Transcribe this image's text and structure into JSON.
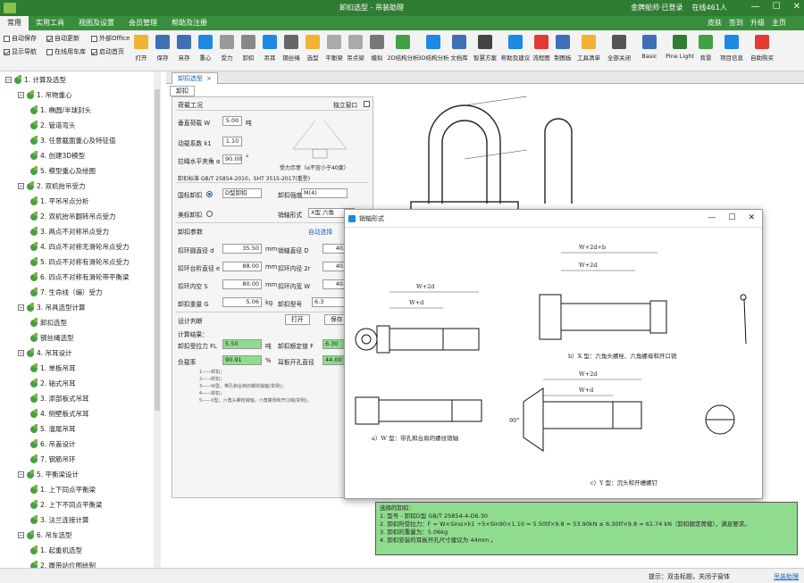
{
  "window": {
    "title": "卸扣选型 - 吊装助理",
    "user_status": "金牌船师·已登录",
    "online": "在线461人",
    "controls": [
      "—",
      "☐",
      "✕"
    ]
  },
  "menu": {
    "items": [
      "常用",
      "实用工具",
      "视图及设置",
      "会员管理",
      "帮助及注册"
    ],
    "right": [
      "皮肤",
      "签到",
      "升级",
      "主页"
    ]
  },
  "ribbon": {
    "checkboxes": [
      {
        "label": "自动保存",
        "checked": false
      },
      {
        "label": "自动更新",
        "checked": true
      },
      {
        "label": "外部Office",
        "checked": false
      },
      {
        "label": "显示导航",
        "checked": true
      },
      {
        "label": "在线用车库",
        "checked": false
      },
      {
        "label": "启动首页",
        "checked": true
      }
    ],
    "tools": [
      {
        "label": "打开",
        "icon": "folder-icon",
        "color": "#f2b233"
      },
      {
        "label": "保存",
        "icon": "save-icon",
        "color": "#3f6fb5"
      },
      {
        "label": "另存",
        "icon": "save-as-icon",
        "color": "#3f6fb5"
      },
      {
        "label": "重心",
        "icon": "center-icon",
        "color": "#1e88e5"
      },
      {
        "label": "受力",
        "icon": "force-icon",
        "color": "#999999"
      },
      {
        "label": "卸扣",
        "icon": "shackle-icon",
        "color": "#888888"
      },
      {
        "label": "吊耳",
        "icon": "lug-icon",
        "color": "#1e88e5"
      },
      {
        "label": "钢丝绳",
        "icon": "rope-icon",
        "color": "#666666"
      },
      {
        "label": "选型",
        "icon": "crane-icon",
        "color": "#f2b233"
      },
      {
        "label": "平衡梁",
        "icon": "beam-icon",
        "color": "#aaaaaa"
      },
      {
        "label": "吊点梁",
        "icon": "point-beam-icon",
        "color": "#aaaaaa"
      },
      {
        "label": "模拟",
        "icon": "simulate-icon",
        "color": "#777777"
      },
      {
        "label": "2D结构分析",
        "icon": "2d-analysis-icon",
        "color": "#43a047"
      },
      {
        "label": "3D结构分析",
        "icon": "3d-analysis-icon",
        "color": "#1e88e5"
      },
      {
        "label": "文档库",
        "icon": "library-icon",
        "color": "#3f6fb5"
      },
      {
        "label": "智慧方案",
        "icon": "scheme-icon",
        "color": "#444444"
      },
      {
        "label": "帮助及建议",
        "icon": "help-monitor-icon",
        "color": "#1e88e5"
      },
      {
        "label": "流程图",
        "icon": "flowchart-icon",
        "color": "#e53935"
      },
      {
        "label": "制图板",
        "icon": "drawing-board-icon",
        "color": "#3f6fb5"
      },
      {
        "label": "工具清单",
        "icon": "clipboard-icon",
        "color": "#f2b233"
      },
      {
        "label": "全部关闭",
        "icon": "close-all-icon",
        "color": "#555555"
      },
      {
        "label": "Basic",
        "icon": "basic-theme-icon",
        "color": "#3f6fb5"
      },
      {
        "label": "Pine Light",
        "icon": "pine-light-icon",
        "color": "#2e7d32"
      },
      {
        "label": "背景",
        "icon": "background-icon",
        "color": "#43a047"
      },
      {
        "label": "项目信息",
        "icon": "info-icon",
        "color": "#1e88e5"
      },
      {
        "label": "自助购买",
        "icon": "cart-icon",
        "color": "#e53935"
      }
    ]
  },
  "tree": [
    {
      "level": 0,
      "expander": "−",
      "label": "1. 计算及选型"
    },
    {
      "level": 1,
      "expander": "−",
      "label": "1. 吊物重心"
    },
    {
      "level": 2,
      "label": "1. 椭圆/半球封头"
    },
    {
      "level": 2,
      "label": "2. 管道弯头"
    },
    {
      "level": 2,
      "label": "3. 任意截面重心及特征值"
    },
    {
      "level": 2,
      "label": "4. 创建3D模型"
    },
    {
      "level": 2,
      "label": "5. 模型重心及绘图"
    },
    {
      "level": 1,
      "expander": "−",
      "label": "2. 双机抬吊受力"
    },
    {
      "level": 2,
      "label": "1. 平吊吊点分析"
    },
    {
      "level": 2,
      "label": "2. 双机抬吊翻转吊点受力"
    },
    {
      "level": 2,
      "label": "3. 两点不对称吊点受力"
    },
    {
      "level": 2,
      "label": "4. 四点不对称无滑轮吊点受力"
    },
    {
      "level": 2,
      "label": "5. 四点不对称有滑轮吊点受力"
    },
    {
      "level": 2,
      "label": "6. 四点不对称有滑轮带平衡梁"
    },
    {
      "level": 2,
      "label": "7. 生命线（编）受力"
    },
    {
      "level": 1,
      "expander": "−",
      "label": "3. 吊具选型计算"
    },
    {
      "level": 2,
      "label": "卸扣选型"
    },
    {
      "level": 2,
      "label": "钢丝绳选型"
    },
    {
      "level": 1,
      "expander": "−",
      "label": "4. 吊耳设计"
    },
    {
      "level": 2,
      "label": "1. 单板吊耳"
    },
    {
      "level": 2,
      "label": "2. 轴式吊耳"
    },
    {
      "level": 2,
      "label": "3. 添部板式吊耳"
    },
    {
      "level": 2,
      "label": "4. 侧壁板式吊耳"
    },
    {
      "level": 2,
      "label": "5. 溜尾吊耳"
    },
    {
      "level": 2,
      "label": "6. 吊盖设计"
    },
    {
      "level": 2,
      "label": "7. 钢筋吊环"
    },
    {
      "level": 1,
      "expander": "−",
      "label": "5. 平衡梁设计"
    },
    {
      "level": 2,
      "label": "1. 上下同点平衡梁"
    },
    {
      "level": 2,
      "label": "2. 上下不同点平衡梁"
    },
    {
      "level": 2,
      "label": "3. 法兰连接计算"
    },
    {
      "level": 1,
      "expander": "−",
      "label": "6. 吊车选型"
    },
    {
      "level": 2,
      "label": "1. 起重机选型"
    },
    {
      "level": 2,
      "label": "2. 履带站位图绘制"
    }
  ],
  "doc_tab": {
    "label": "卸扣选型",
    "close": "×"
  },
  "inner_tab": "卸扣",
  "form": {
    "load_title": "荷载工况",
    "independent_window": "独立窗口",
    "vertical_load_label": "垂直荷载 W",
    "vertical_load": "5.00",
    "vertical_load_unit": "吨",
    "dynamic_coef_label": "动载系数 k1",
    "dynamic_coef": "1.10",
    "angle_label": "拉绳水平夹角 α",
    "angle": "90.00",
    "angle_unit": "°",
    "diagram_caption": "受力示意（α不宜小于40度）",
    "standard_label": "卸扣标准 GB/T 25854-2010，SHT 3515-2017(重型)",
    "national_label": "国标卸扣",
    "national_type": "D型卸扣",
    "strength_label": "卸扣强度",
    "strength": "M(4)",
    "american_label": "美标卸扣",
    "pin_type_label": "销轴形式",
    "pin_type": "X型 六角",
    "params_title": "卸扣参数",
    "auto_select": "自动选择",
    "params": [
      {
        "label": "扣环圆直径 d",
        "value": "35.50",
        "unit": "mm",
        "label2": "销轴直径 D",
        "value2": "40."
      },
      {
        "label": "扣环台阶直径 e",
        "value": "88.00",
        "unit": "mm",
        "label2": "扣环内径 2r",
        "value2": "40."
      },
      {
        "label": "扣环内空 S",
        "value": "80.00",
        "unit": "mm",
        "label2": "扣环内宽 W",
        "value2": "40."
      },
      {
        "label": "卸扣重量 G",
        "value": "5.06",
        "unit": "kg",
        "label2": "卸扣型号",
        "value2": "6.3"
      }
    ],
    "design_title": "设计判断",
    "open_button": "打开",
    "save_button": "保存",
    "result_title": "计算结果：",
    "results": [
      {
        "label": "卸扣受拉力 FL",
        "value": "5.50",
        "unit": "吨",
        "label2": "卸扣额定值 F",
        "value2": "6.30"
      },
      {
        "label": "负载率",
        "value": "90.91",
        "unit": "%",
        "label2": "耳板开孔直径",
        "value2": "44.00"
      }
    ],
    "notes": [
      "1——卸扣；",
      "2——卸扣；",
      "3——W型，带孔和台肩的螺纹销轴(举例)；",
      "4——卸扣；",
      "5——X型，六角头螺栓销轴，六角螺母和开口销(举例)。"
    ]
  },
  "modal": {
    "title": "销轴形式",
    "controls": [
      "—",
      "☐",
      "✕"
    ],
    "captions": {
      "w": "a）W 型：带孔和台肩的螺纹销轴",
      "x": "b）X 型：六角头螺栓、六角螺母和开口销",
      "y": "c）Y 型：沉头和开槽螺钉",
      "dim1": "W+2d+b",
      "dim2": "W+2d",
      "dim3": "W+d",
      "dim4": "90°"
    }
  },
  "results_text": [
    "选择的卸扣：",
    "1. 型号 - 卸扣D型 GB/T 25854-4-D6.30",
    "2. 卸扣所受拉力：F = W×Sinα×k1 ÷5×Sin90×1.10 = 5.50tf×9.8 = 53.90kN ≤ 6.30tf×9.8 = 61.74 kN（卸扣额定荷载），满足要求。",
    "3. 卸扣的重量为：5.06kg",
    "4. 卸扣安装的耳板开孔尺寸建议为 44mm 。"
  ],
  "status": {
    "hint": "提示：双击标题，关闭子窗体",
    "right": "吊装助理"
  }
}
